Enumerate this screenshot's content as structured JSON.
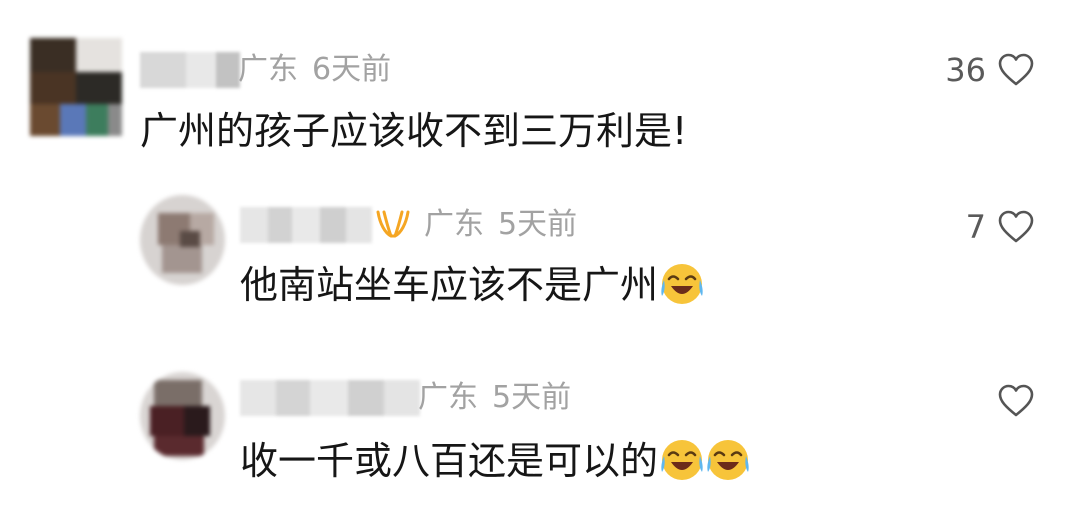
{
  "comments": [
    {
      "location": "广东",
      "time": "6天前",
      "text": "广州的孩子应该收不到三万利是!",
      "likes": "36",
      "location_partial": "广东"
    },
    {
      "location": "广东",
      "time": "5天前",
      "text": "他南站坐车应该不是广州",
      "likes": "7",
      "has_author_badge": true,
      "emoji": [
        "crying-laughing-emoji"
      ]
    },
    {
      "location": "广东",
      "time": "5天前",
      "text": "收一千或八百还是可以的",
      "likes": "",
      "emoji": [
        "crying-laughing-emoji",
        "crying-laughing-emoji"
      ]
    }
  ],
  "colors": {
    "meta_gray": "#a2a2a2",
    "text_dark": "#161616",
    "badge_orange": "#f5a623",
    "heart_outline": "#555555",
    "emoji_yellow": "#f7c43a"
  },
  "icons": {
    "like": "heart-outline-icon",
    "badge": "author-badge-icon",
    "emoji": "face-with-tears-of-joy-emoji"
  }
}
